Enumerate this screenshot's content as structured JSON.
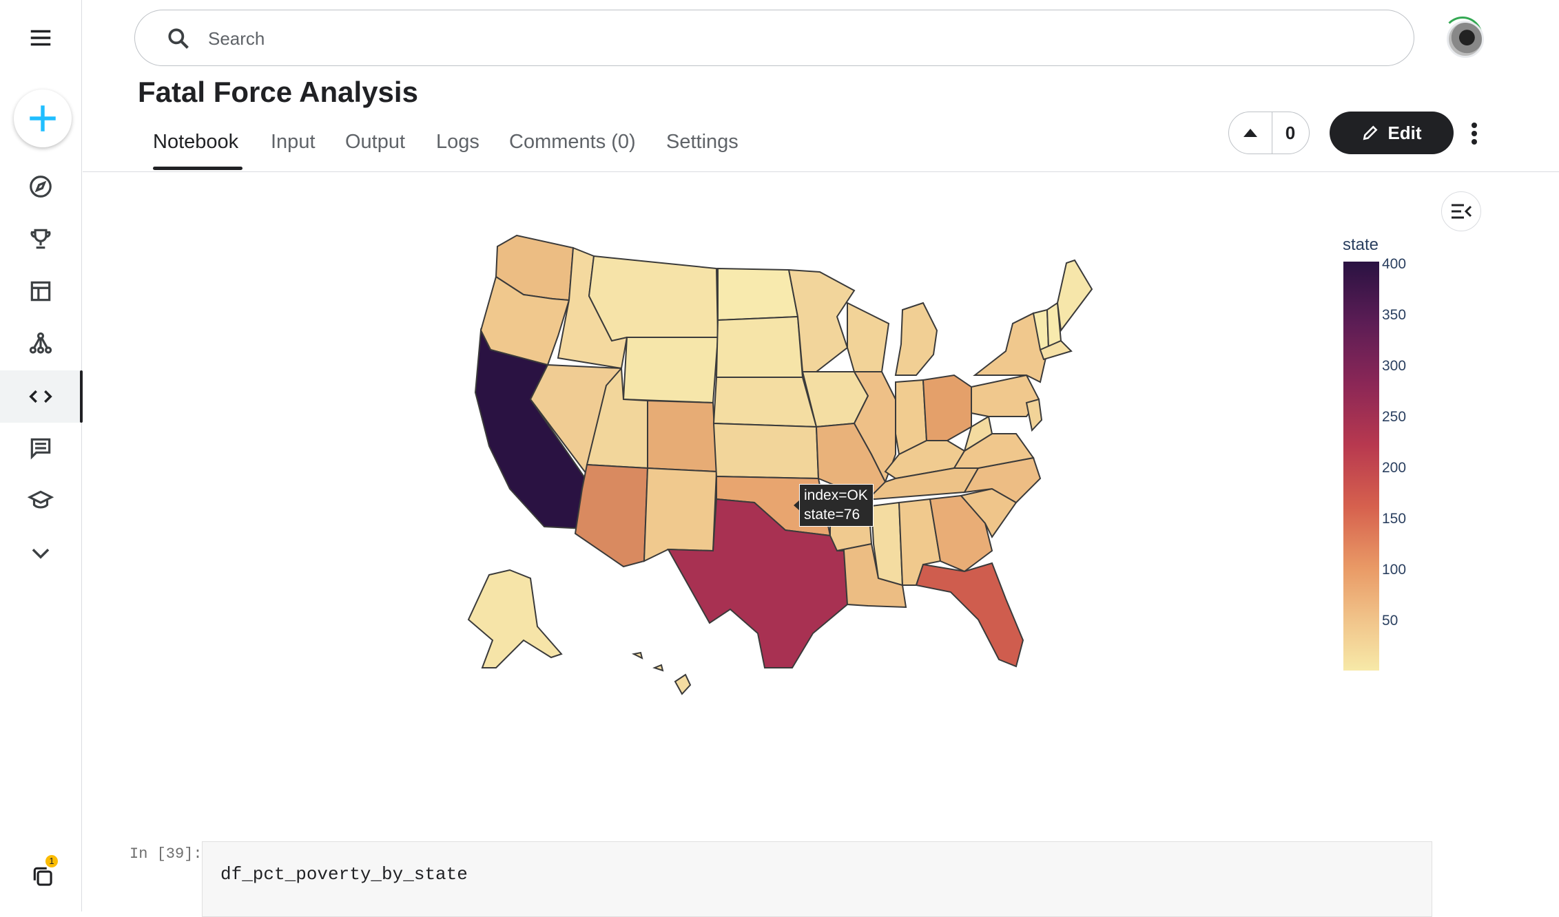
{
  "search": {
    "placeholder": "Search"
  },
  "page": {
    "title": "Fatal Force Analysis"
  },
  "tabs": [
    {
      "label": "Notebook"
    },
    {
      "label": "Input"
    },
    {
      "label": "Output"
    },
    {
      "label": "Logs"
    },
    {
      "label": "Comments (0)"
    },
    {
      "label": "Settings"
    }
  ],
  "toolbar": {
    "vote_count": "0",
    "edit_label": "Edit"
  },
  "sidebar": {
    "icons": [
      "menu-icon",
      "create-icon",
      "compass-icon",
      "trophy-icon",
      "table-icon",
      "models-icon",
      "code-icon",
      "discussion-icon",
      "learn-icon",
      "chevron-down-icon"
    ],
    "notification_count": "1"
  },
  "chart_data": {
    "type": "choropleth",
    "legend_title": "state",
    "colorbar_ticks": [
      "400",
      "350",
      "300",
      "250",
      "200",
      "150",
      "100",
      "50"
    ],
    "colorscale": [
      "#2a1242",
      "#5c1d55",
      "#8b2756",
      "#b8394f",
      "#d6614e",
      "#e99a66",
      "#f1c58b",
      "#f7e9a8"
    ],
    "range": [
      0,
      424
    ],
    "locations": [
      "CA",
      "TX",
      "FL",
      "AZ",
      "OK",
      "CO",
      "GA",
      "OH",
      "WA",
      "NC",
      "MO",
      "TN",
      "LA"
    ],
    "values": [
      424,
      225,
      154,
      118,
      76,
      74,
      70,
      79,
      62,
      69,
      64,
      59,
      57
    ],
    "tooltip": {
      "line1": "index=OK",
      "line2": "state=76"
    }
  },
  "cell": {
    "prompt": "In [39]:",
    "code": "df_pct_poverty_by_state"
  }
}
